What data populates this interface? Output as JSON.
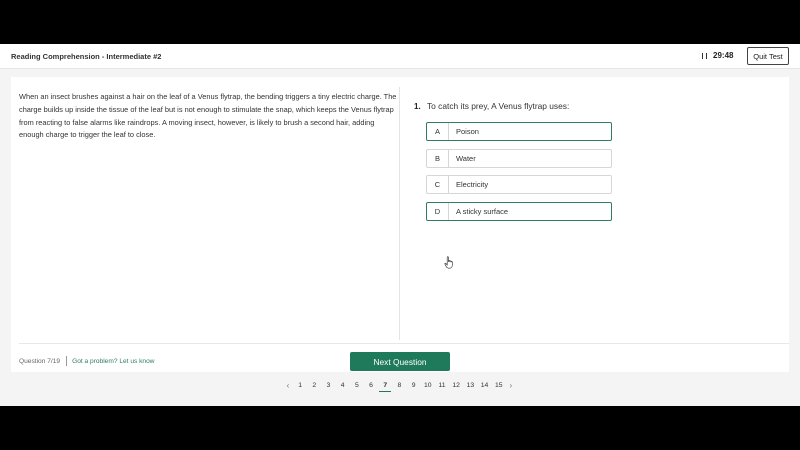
{
  "header": {
    "title": "Reading Comprehension - Intermediate #2",
    "timer": "29:48",
    "quit_label": "Quit Test"
  },
  "passage": "When an insect brushes against a hair on the leaf of a Venus flytrap, the bending triggers a tiny electric charge. The charge builds up inside the tissue of the leaf but is not enough to stimulate the snap, which keeps the Venus flytrap from reacting to false alarms like raindrops. A moving insect, however, is likely to brush a second hair, adding enough charge to trigger the leaf to close.",
  "question": {
    "number": "1.",
    "text": "To catch its prey, A Venus flytrap uses:",
    "options": [
      {
        "letter": "A",
        "text": "Poison"
      },
      {
        "letter": "B",
        "text": "Water"
      },
      {
        "letter": "C",
        "text": "Electricity"
      },
      {
        "letter": "D",
        "text": "A sticky surface"
      }
    ]
  },
  "footer": {
    "progress": "Question 7/19",
    "report_link": "Got a problem? Let us know",
    "next_label": "Next Question"
  },
  "pagination": {
    "pages": [
      "1",
      "2",
      "3",
      "4",
      "5",
      "6",
      "7",
      "8",
      "9",
      "10",
      "11",
      "12",
      "13",
      "14",
      "15"
    ],
    "current": "7",
    "prev_icon": "‹",
    "next_icon": "›"
  },
  "colors": {
    "accent": "#1f7a5c",
    "highlight_border": "#2e7d62",
    "background": "#f4f4f4"
  }
}
